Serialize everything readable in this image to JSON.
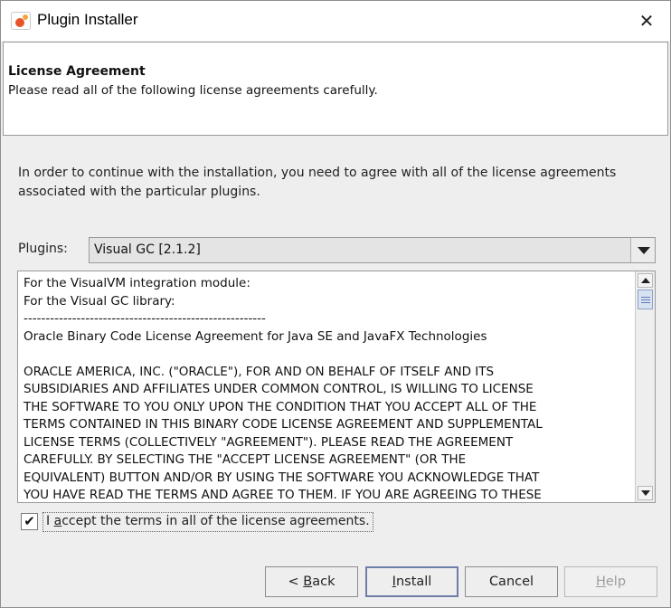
{
  "window": {
    "title": "Plugin Installer",
    "close_glyph": "✕"
  },
  "header": {
    "title": "License Agreement",
    "subtitle": "Please read all of the following license agreements carefully."
  },
  "intro_text": "In order to continue with the installation, you need to agree with all of the license agreements associated with the particular plugins.",
  "plugins": {
    "label": "Plugins:",
    "selected": "Visual GC [2.1.2]"
  },
  "license": {
    "lines": [
      "For the VisualVM integration module:",
      "For the Visual GC library:",
      "-------------------------------------------------------",
      "Oracle Binary Code License Agreement for Java SE and JavaFX Technologies",
      "",
      "ORACLE AMERICA, INC. (\"ORACLE\"), FOR AND ON BEHALF OF ITSELF AND ITS",
      "SUBSIDIARIES AND AFFILIATES UNDER COMMON CONTROL, IS WILLING TO LICENSE",
      "THE SOFTWARE TO YOU ONLY UPON THE CONDITION THAT YOU ACCEPT ALL OF THE",
      "TERMS CONTAINED IN THIS BINARY CODE LICENSE AGREEMENT AND SUPPLEMENTAL",
      "LICENSE TERMS (COLLECTIVELY \"AGREEMENT\"). PLEASE READ THE AGREEMENT",
      "CAREFULLY. BY SELECTING THE \"ACCEPT LICENSE AGREEMENT\" (OR THE",
      "EQUIVALENT) BUTTON AND/OR BY USING THE SOFTWARE YOU ACKNOWLEDGE THAT",
      "YOU HAVE READ THE TERMS AND AGREE TO THEM. IF YOU ARE AGREEING TO THESE"
    ]
  },
  "accept": {
    "checked": true,
    "check_glyph": "✔",
    "pre": "I ",
    "mnemonic": "a",
    "post": "ccept the terms in all of the license agreements."
  },
  "buttons": {
    "back": {
      "pre": "< ",
      "mnemonic": "B",
      "post": "ack"
    },
    "install": {
      "pre": "",
      "mnemonic": "I",
      "post": "nstall"
    },
    "cancel": {
      "label": "Cancel"
    },
    "help": {
      "pre": "",
      "mnemonic": "H",
      "post": "elp"
    }
  }
}
